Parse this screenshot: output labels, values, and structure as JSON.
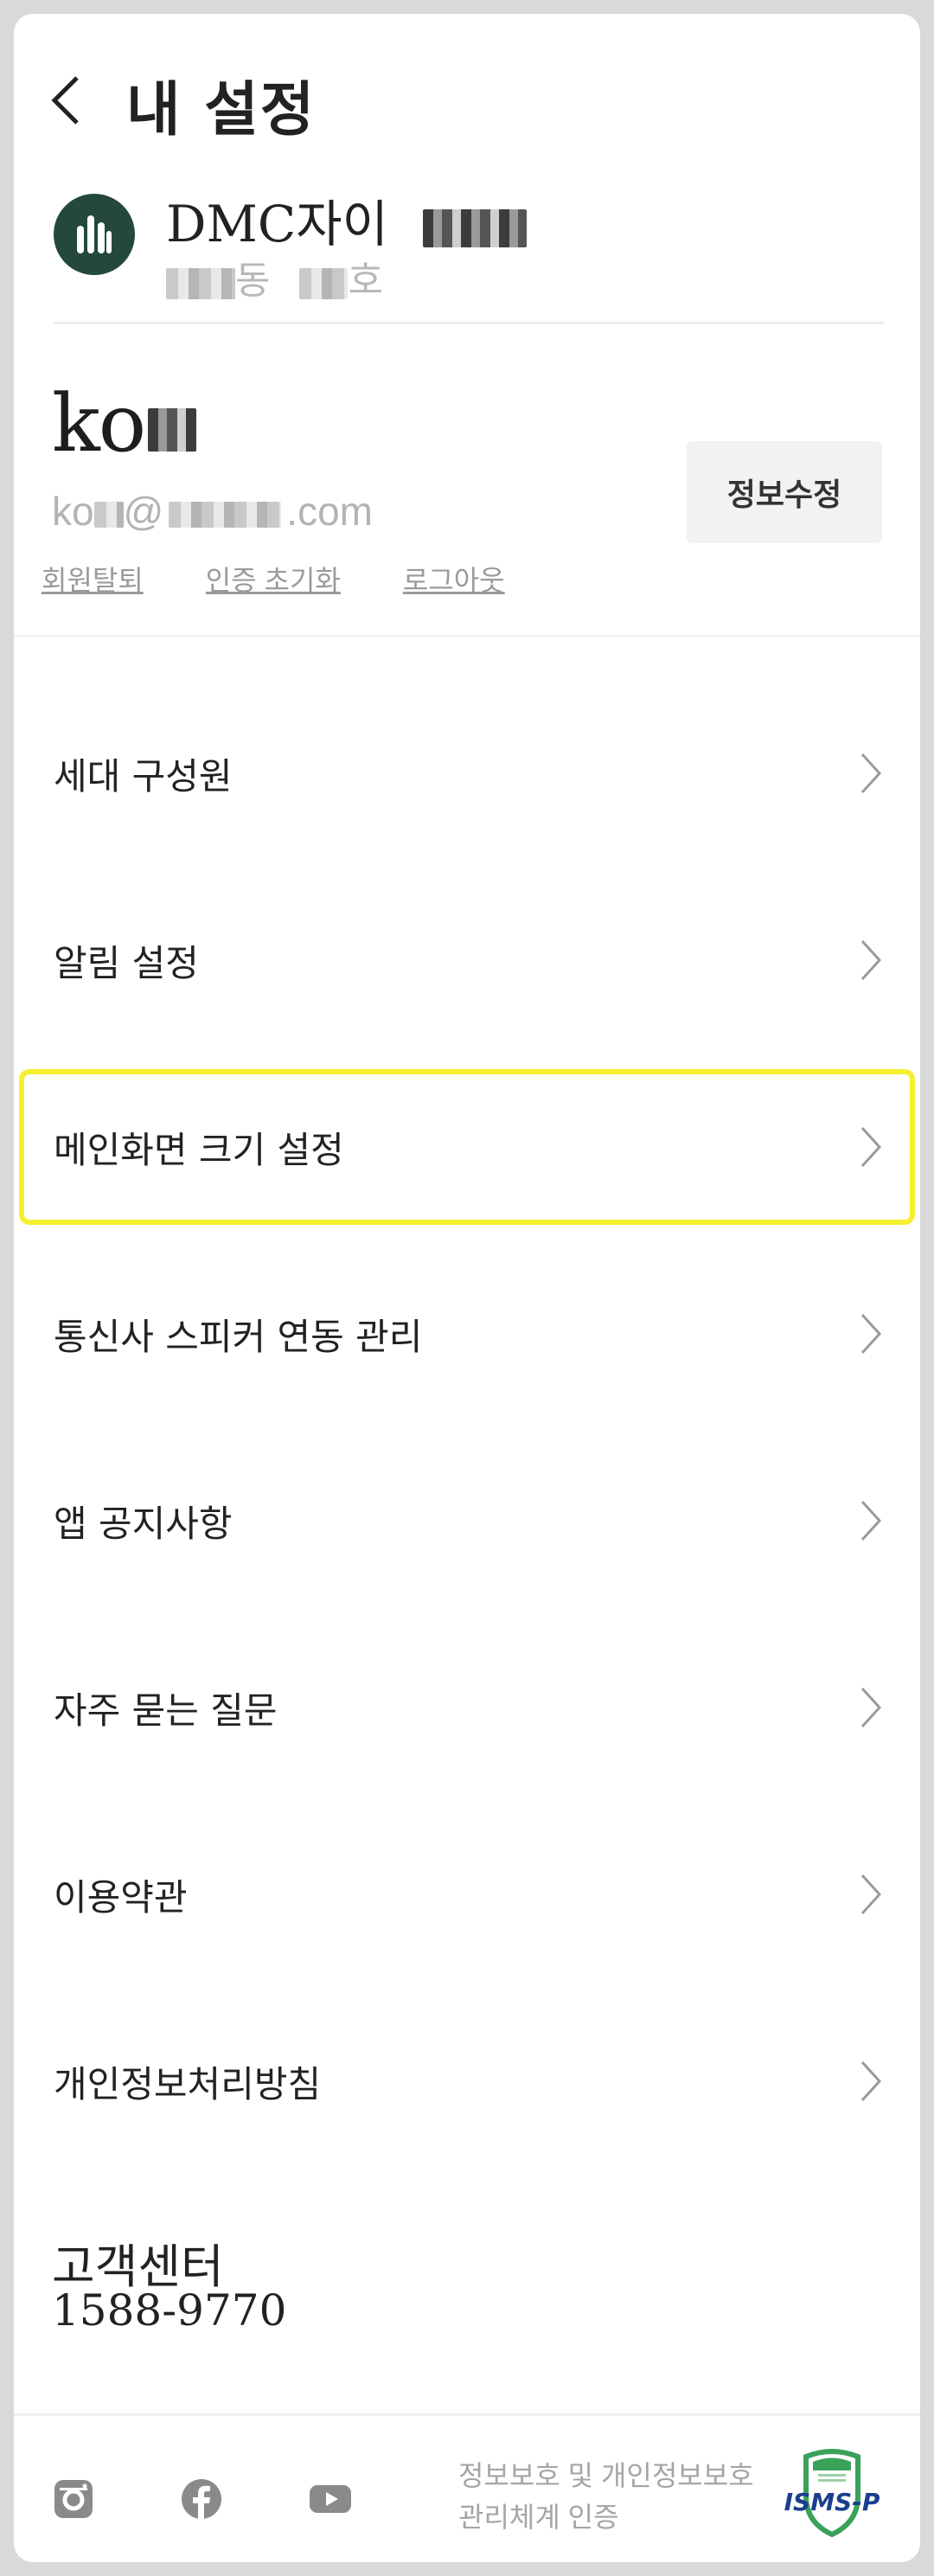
{
  "header": {
    "title": "내 설정",
    "back_icon": "chevron-left-icon"
  },
  "apartment": {
    "logo_icon": "building-icon",
    "name": "DMC자이",
    "unit_dong": "동",
    "unit_ho": "호"
  },
  "user": {
    "name": "ko",
    "email_prefix": "ko",
    "email_at": "@",
    "email_suffix": ".com",
    "edit_label": "정보수정",
    "links": {
      "withdraw": "회원탈퇴",
      "reset_auth": "인증 초기화",
      "logout": "로그아웃"
    }
  },
  "menu": {
    "items": [
      {
        "label": "세대 구성원"
      },
      {
        "label": "알림 설정"
      },
      {
        "label": "메인화면 크기 설정",
        "highlighted": true
      },
      {
        "label": "통신사 스피커 연동 관리"
      },
      {
        "label": "앱 공지사항"
      },
      {
        "label": "자주 묻는 질문"
      },
      {
        "label": "이용약관"
      },
      {
        "label": "개인정보처리방침"
      }
    ]
  },
  "customer_center": {
    "title": "고객센터",
    "phone": "1588-9770"
  },
  "footer": {
    "social_icons": [
      "instagram-icon",
      "facebook-icon",
      "youtube-icon"
    ],
    "cert_line1": "정보보호 및 개인정보보호",
    "cert_line2": "관리체계 인증",
    "cert_badge_text": "ISMS-P"
  },
  "colors": {
    "brand_green": "#24493a",
    "highlight_yellow": "#f5ef2f",
    "badge_green": "#3aa15a",
    "badge_blue": "#1b3e8f"
  }
}
